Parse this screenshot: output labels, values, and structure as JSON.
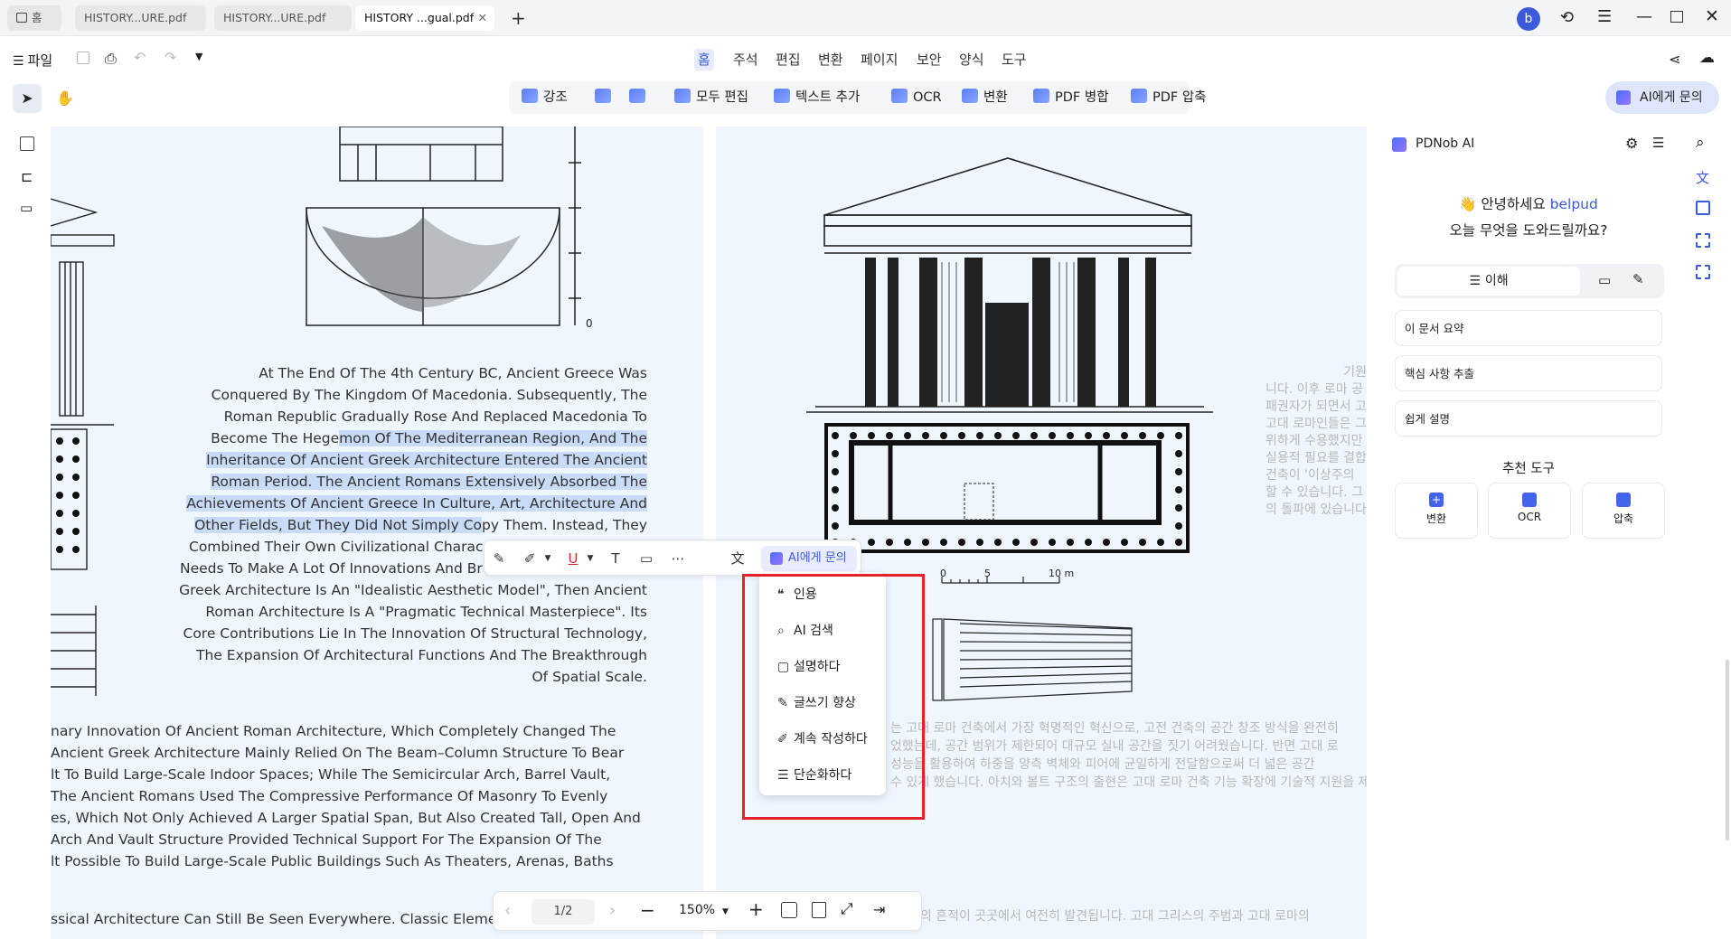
{
  "tabs": [
    {
      "label": "홈"
    },
    {
      "label": "HISTORY...URE.pdf"
    },
    {
      "label": "HISTORY...URE.pdf"
    },
    {
      "label": "HISTORY ...gual.pdf",
      "close": "✕"
    }
  ],
  "avatar_letter": "b",
  "file_menu": "파일",
  "menu_tabs": [
    "홈",
    "주석",
    "편집",
    "변환",
    "페이지",
    "보안",
    "양식",
    "도구"
  ],
  "toolbar": {
    "highlight": "강조",
    "edit_all": "모두 편집",
    "add_text": "텍스트 추가",
    "ocr": "OCR",
    "convert": "변환",
    "merge": "PDF 병합",
    "compress": "PDF 압축"
  },
  "ask_ai_button": "AI에게 문의",
  "page1_paragraph": [
    "At The End Of The 4th Century BC, Ancient Greece Was",
    "Conquered By The Kingdom Of Macedonia. Subsequently, The",
    "Roman Republic Gradually Rose And Replaced Macedonia To",
    [
      "Become The Hege",
      "mon Of The Mediterranean Region, And The"
    ],
    "Inheritance Of Ancient Greek Architecture Entered The Ancient",
    "Roman Period. The Ancient Romans Extensively Absorbed The",
    "Achievements Of Ancient Greece In Culture, Art, Architecture And",
    [
      "Other Fields, But They Did Not Simply Co",
      "py Them. Instead, They"
    ],
    "Combined Their Own Civilizational Charac",
    "Needs To Make A Lot Of Innovations And Br",
    "Greek Architecture Is An \"Idealistic Aesthetic Model\", Then Ancient",
    "Roman Architecture Is A \"Pragmatic Technical Masterpiece\". Its",
    "Core Contributions Lie In The Innovation Of Structural Technology,",
    "The Expansion Of Architectural Functions And The Breakthrough",
    "Of Spatial Scale."
  ],
  "page1_lower": [
    "nary Innovation Of Ancient Roman Architecture, Which Completely Changed The",
    "Ancient Greek Architecture Mainly Relied On The Beam–Column Structure To Bear",
    "lt To Build Large-Scale Indoor Spaces; While The Semicircular Arch, Barrel Vault,",
    "The Ancient Romans Used The Compressive Performance Of Masonry To Evenly",
    "es, Which Not Only Achieved A Larger Spatial Span, But Also Created Tall, Open And",
    "Arch And Vault Structure Provided Technical Support For The Expansion Of The",
    "lt Possible To Build Large-Scale Public Buildings Such As Theaters, Arenas, Baths",
    "ssical Architecture Can Still Be Seen Everywhere. Classic Eleme"
  ],
  "page2_korean_right": [
    "기원",
    "니다. 이후 로마 공",
    "패권자가 되면서 고",
    "고대 로마인들은 그",
    "위하게 수용했지만",
    "실용적 필요를 결합",
    "건축이 '이상주의",
    "할 수 있습니다. 그",
    "의 돌파에 있습니다"
  ],
  "page2_korean_lower": [
    "는 고대 로마 건축에서 가장 혁명적인 혁신으로, 고전 건축의 공간 창조 방식을 완전히",
    "었했는데, 공간 범위가 제한되어 대규모 실내 공간을 짓기 어려웠습니다. 반면 고대 로",
    "성능을 활용하여 하중을 양측 벽체와 피어에 균일하게 전달함으로써 더 넓은 공간",
    "수 있게 했습니다. 아치와 볼트 구조의 출현은 고대 로마 건축 기능 확장에 기술적 지원을 제공하여 극",
    "축의 흔적이 곳곳에서 여전히 발견됩니다. 고대 그리스의 주범과 고대 로마의"
  ],
  "scale": {
    "zero": "0",
    "five": "5",
    "ten": "10 m"
  },
  "figure_scale_zero": "0",
  "float_toolbar_ask": "AI에게 문의",
  "ai_menu": [
    "인용",
    "AI 검색",
    "설명하다",
    "글쓰기 향상",
    "계속 작성하다",
    "단순화하다"
  ],
  "ai_menu_icons": [
    "❝",
    "⌕",
    "▢",
    "✎",
    "✐",
    "☰"
  ],
  "pager": {
    "page": "1/2",
    "zoom": "150%"
  },
  "panel": {
    "title": "PDNob AI",
    "greeting": "안녕하세요",
    "username": "belpud",
    "question": "오늘 무엇을 도와드릴까요?",
    "mode_tab": "이해",
    "suggestions": [
      "이 문서 요약",
      "핵심 사항 추출",
      "쉽게 설명"
    ],
    "tools_heading": "추천 도구",
    "tools": [
      "변환",
      "OCR",
      "압축"
    ]
  },
  "colors": {
    "accent": "#3b5bdb",
    "highlight": "#c9dcf7",
    "red_box": "#e3222b",
    "doc_bg": "#eff6fe"
  }
}
